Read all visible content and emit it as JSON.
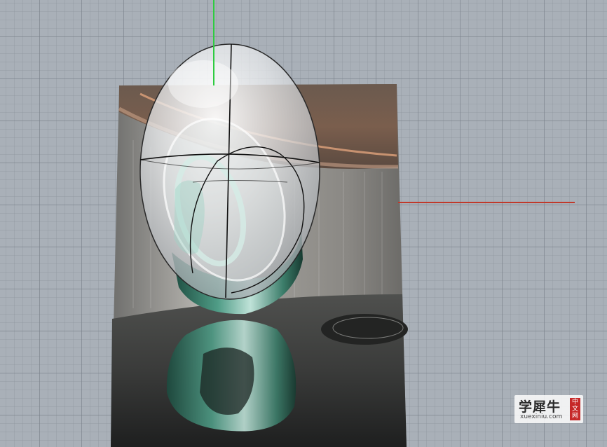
{
  "viewport": {
    "name": "perspective-viewport",
    "colors": {
      "background": "#a9b0b8",
      "grid_line": "#78808a",
      "x_axis": "#c0392b",
      "y_axis": "#2ecc40"
    }
  },
  "reference_image": {
    "description_icon": "reference-picture-plane"
  },
  "watermark": {
    "brand": "学犀牛",
    "url": "xuexiniu.com",
    "seal": "中文网"
  }
}
